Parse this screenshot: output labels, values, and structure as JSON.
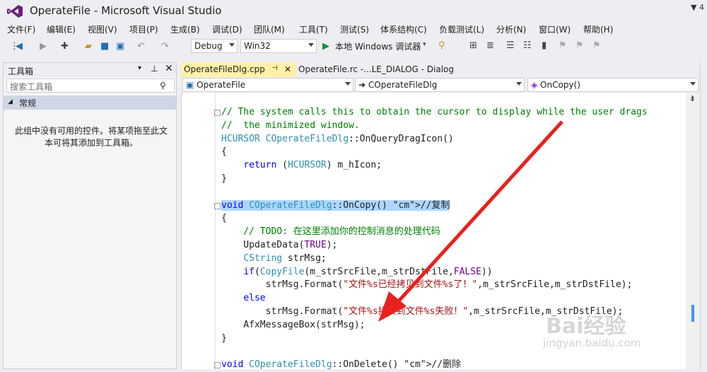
{
  "window": {
    "title": "OperateFile - Microsoft Visual Studio",
    "top_right": "4"
  },
  "menu": [
    "文件(F)",
    "编辑(E)",
    "视图(V)",
    "项目(P)",
    "生成(B)",
    "调试(D)",
    "团队(M)",
    "工具(T)",
    "测试(S)",
    "体系结构(C)",
    "负载测试(L)",
    "分析(N)",
    "窗口(W)",
    "帮助(H)"
  ],
  "toolbar": {
    "config": "Debug",
    "platform": "Win32",
    "run": "本地 Windows 调试器"
  },
  "toolbox": {
    "title": "工具箱",
    "search_placeholder": "搜索工具箱",
    "group": "常规",
    "empty_message": "此组中没有可用的控件。将某项拖至此文本可将其添加到工具箱。"
  },
  "tabs": [
    {
      "label": "OperateFileDlg.cpp",
      "active": true
    },
    {
      "label": "OperateFile.rc -...LE_DIALOG - Dialog",
      "active": false
    }
  ],
  "nav": {
    "scope": "OperateFile",
    "class": "COperateFileDlg",
    "member": "OnCopy()"
  },
  "code_lines": [
    {
      "t": "// The system calls this to obtain the cursor to display while the user drags",
      "fold": true
    },
    {
      "t": "//  the minimized window."
    },
    {
      "t": "HCURSOR COperateFileDlg::OnQueryDragIcon()"
    },
    {
      "t": "{"
    },
    {
      "t": "    return (HCURSOR) m_hIcon;"
    },
    {
      "t": "}"
    },
    {
      "t": ""
    },
    {
      "t": "void COperateFileDlg::OnCopy() //复制",
      "fold": true
    },
    {
      "t": "{"
    },
    {
      "t": "    // TODO: 在这里添加你的控制消息的处理代码"
    },
    {
      "t": "    UpdateData(TRUE);"
    },
    {
      "t": "    CString strMsg;"
    },
    {
      "t": "    if(CopyFile(m_strSrcFile,m_strDstFile,FALSE))"
    },
    {
      "t": "        strMsg.Format(\"文件%s已经拷贝到文件%s了！\",m_strSrcFile,m_strDstFile);"
    },
    {
      "t": "    else"
    },
    {
      "t": "        strMsg.Format(\"文件%s拷贝到文件%s失败！\",m_strSrcFile,m_strDstFile);"
    },
    {
      "t": "    AfxMessageBox(strMsg);"
    },
    {
      "t": "}"
    },
    {
      "t": ""
    },
    {
      "t": "void COperateFileDlg::OnDelete() //删除",
      "fold": true
    }
  ],
  "watermark": {
    "text": "Bai经验",
    "url": "jingyan.baidu.com"
  }
}
